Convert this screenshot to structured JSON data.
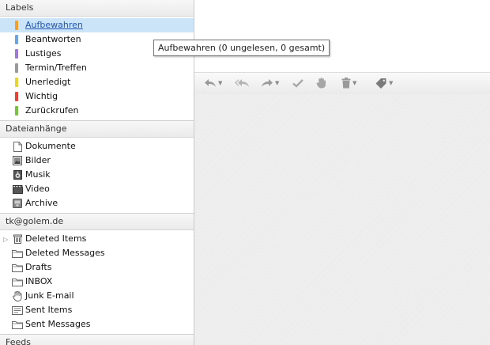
{
  "sidebar": {
    "labels": {
      "header": "Labels",
      "items": [
        {
          "label": "Aufbewahren",
          "color": "#f0a030",
          "selected": true
        },
        {
          "label": "Beantworten",
          "color": "#6ea3e0"
        },
        {
          "label": "Lustiges",
          "color": "#9b7ad0"
        },
        {
          "label": "Termin/Treffen",
          "color": "#9a9a9a"
        },
        {
          "label": "Unerledigt",
          "color": "#e6d23a"
        },
        {
          "label": "Wichtig",
          "color": "#e0453a"
        },
        {
          "label": "Zurückrufen",
          "color": "#7ac048"
        }
      ]
    },
    "attachments": {
      "header": "Dateianhänge",
      "items": [
        {
          "label": "Dokumente",
          "icon": "document-icon"
        },
        {
          "label": "Bilder",
          "icon": "image-icon"
        },
        {
          "label": "Musik",
          "icon": "speaker-icon"
        },
        {
          "label": "Video",
          "icon": "film-icon"
        },
        {
          "label": "Archive",
          "icon": "archive-icon"
        }
      ]
    },
    "account": {
      "header": "tk@golem.de",
      "items": [
        {
          "label": "Deleted Items",
          "icon": "trash-icon",
          "expandable": true
        },
        {
          "label": "Deleted Messages",
          "icon": "folder-icon"
        },
        {
          "label": "Drafts",
          "icon": "folder-icon"
        },
        {
          "label": "INBOX",
          "icon": "folder-icon"
        },
        {
          "label": "Junk E-mail",
          "icon": "hand-icon"
        },
        {
          "label": "Sent Items",
          "icon": "sent-icon"
        },
        {
          "label": "Sent Messages",
          "icon": "folder-icon"
        }
      ]
    },
    "feeds": {
      "header": "Feeds"
    }
  },
  "tooltip": {
    "text": "Aufbewahren (0 ungelesen, 0 gesamt)"
  },
  "toolbar": {
    "buttons": [
      "reply-icon",
      "reply-all-icon",
      "forward-icon",
      "checkmark-icon",
      "hand-icon",
      "trash-icon",
      "tag-icon"
    ]
  }
}
